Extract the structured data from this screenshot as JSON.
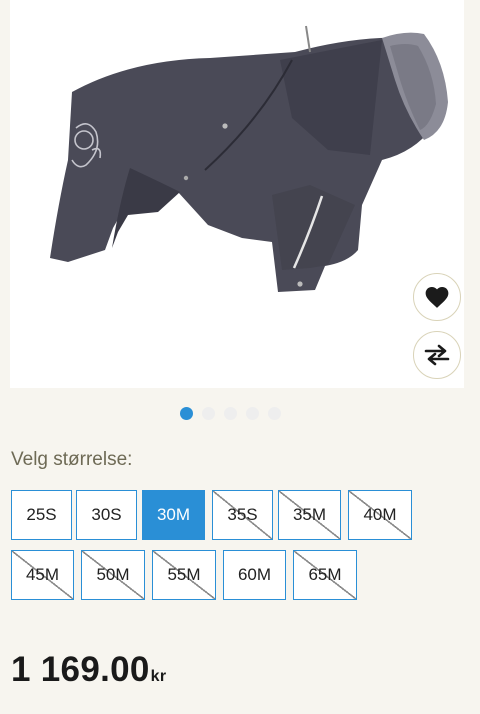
{
  "product": {
    "image_alt": "dog-overall-jacket",
    "colors": {
      "jacket": "#4a4a57",
      "collar": "#8c8c98",
      "reflective": "#e6e6e6"
    }
  },
  "actions": {
    "wishlist_icon": "heart-icon",
    "compare_icon": "swap-arrows-icon"
  },
  "gallery": {
    "total": 5,
    "active": 1
  },
  "size_picker": {
    "label": "Velg størrelse:",
    "sizes": [
      {
        "label": "25S",
        "state": "available"
      },
      {
        "label": "30S",
        "state": "available"
      },
      {
        "label": "30M",
        "state": "selected"
      },
      {
        "label": "35S",
        "state": "unavailable"
      },
      {
        "label": "35M",
        "state": "unavailable"
      },
      {
        "label": "40M",
        "state": "unavailable"
      },
      {
        "label": "45M",
        "state": "unavailable"
      },
      {
        "label": "50M",
        "state": "unavailable"
      },
      {
        "label": "55M",
        "state": "unavailable"
      },
      {
        "label": "60M",
        "state": "available"
      },
      {
        "label": "65M",
        "state": "unavailable"
      }
    ]
  },
  "price": {
    "amount": "1 169.00",
    "currency": "kr"
  },
  "theme": {
    "accent": "#2a8fd6",
    "background": "#f7f5ef"
  }
}
